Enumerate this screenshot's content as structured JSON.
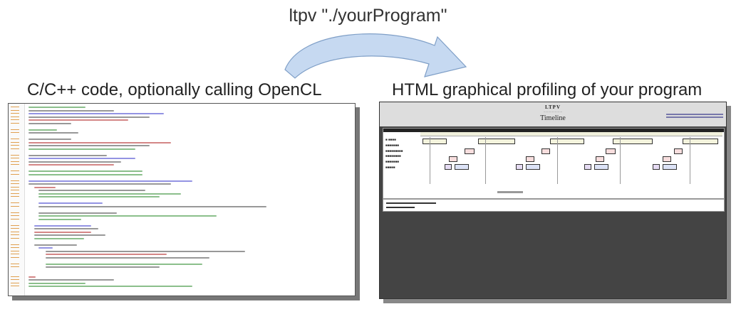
{
  "command": "ltpv \"./yourProgram\"",
  "left_label": "C/C++ code, optionally calling OpenCL",
  "right_label": "HTML graphical profiling of your program",
  "profiler": {
    "brand": "LTPV",
    "title": "Timeline"
  },
  "colors": {
    "arrow_fill": "#c6d9f1",
    "arrow_stroke": "#7f9fc7",
    "browser_bg": "#444444",
    "lane_fill": "#f4f4dd",
    "lane_red": "#c0504d",
    "lane_blue": "#7b7bc8"
  }
}
